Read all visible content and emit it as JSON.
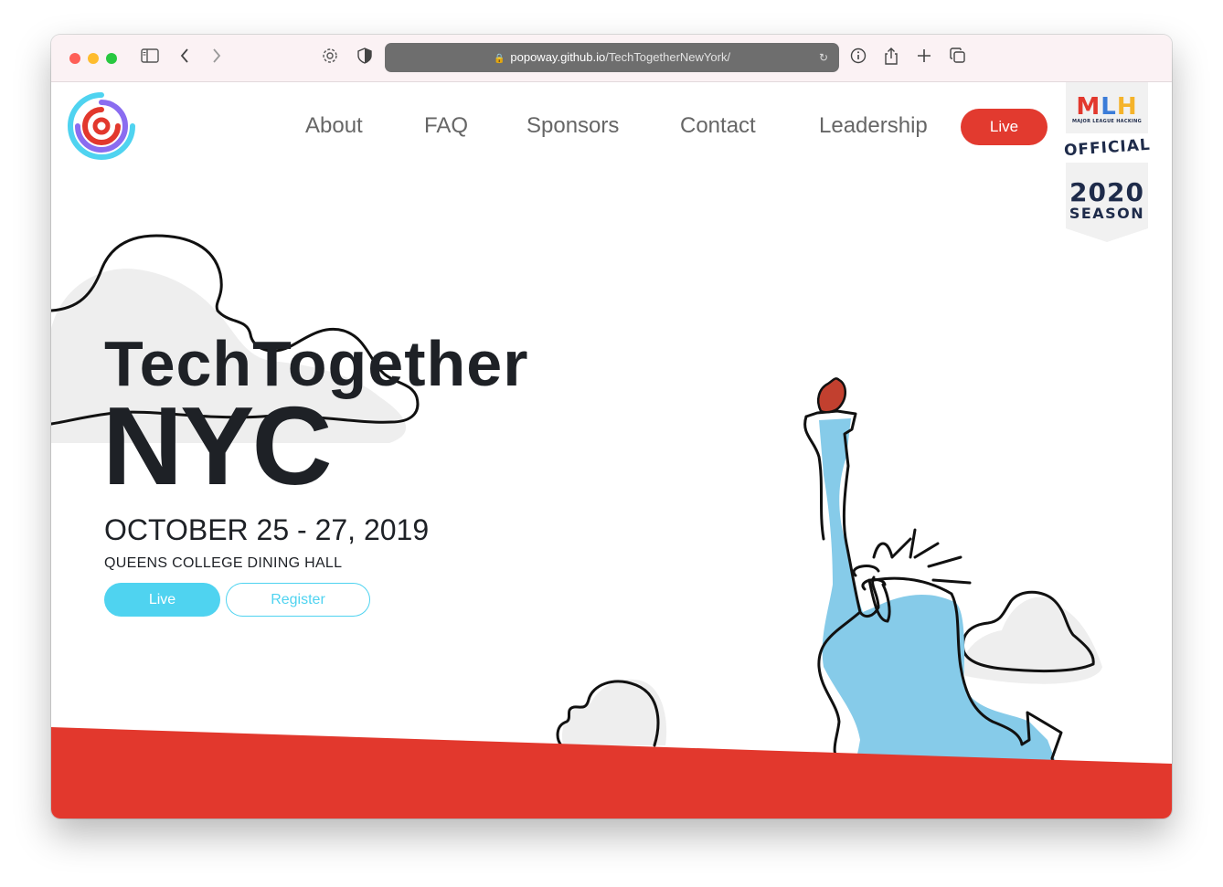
{
  "browser": {
    "url_host": "popoway.github.io",
    "url_path": "/TechTogetherNewYork/"
  },
  "nav": {
    "items": [
      "About",
      "FAQ",
      "Sponsors",
      "Contact",
      "Leadership"
    ],
    "live_label": "Live"
  },
  "mlh_badge": {
    "logo_text": "MLH",
    "tagline": "MAJOR LEAGUE HACKING",
    "official": "OFFICIAL",
    "year": "2020",
    "season": "SEASON"
  },
  "hero": {
    "title": "TechTogether",
    "city": "NYC",
    "date": "OCTOBER 25 - 27, 2019",
    "venue": "QUEENS COLLEGE DINING HALL",
    "live_button": "Live",
    "register_button": "Register"
  },
  "colors": {
    "accent_red": "#e23a2f",
    "accent_cyan": "#4fd3f0",
    "statue_blue": "#86cbe9",
    "text_dark": "#1e2126"
  }
}
